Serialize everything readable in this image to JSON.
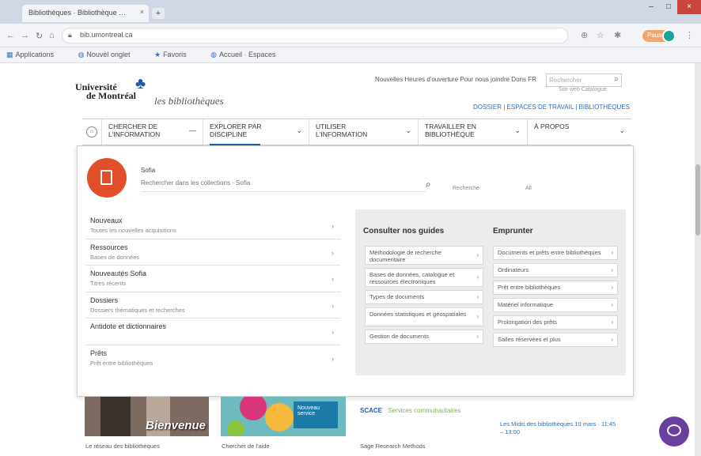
{
  "browser": {
    "tab_title": "Bibliothèques · Bibliothèque …",
    "url": "bib.umontreal.ca",
    "bookmarks": [
      "Applications",
      "Nouvel onglet",
      "Favoris",
      "Accueil · Espaces"
    ],
    "profile_label": "Pause"
  },
  "header": {
    "logo_line1": "Université",
    "logo_line2": "de Montréal",
    "logo_sub": "les bibliothèques",
    "top_links": "Nouvelles  Heures d'ouverture  Pour nous joindre  Dons  FR",
    "search_placeholder": "Rechercher",
    "search_sub": "Site web  Catalogue",
    "right_links": "DOSSIER  |  ESPACES DE TRAVAIL  |  BIBLIOTHÈQUES"
  },
  "nav": {
    "items": [
      {
        "label": "CHERCHER DE\nL'INFORMATION"
      },
      {
        "label": "EXPLORER PAR\nDISCIPLINE"
      },
      {
        "label": "UTILISER\nL'INFORMATION"
      },
      {
        "label": "TRAVAILLER EN\nBIBLIOTHÈQUE"
      },
      {
        "label": "À PROPOS"
      }
    ]
  },
  "mega": {
    "search_label": "Sofia",
    "search_placeholder": "Rechercher dans les collections · Sofia",
    "search_option1": "Recherche",
    "search_option2": "All",
    "left": [
      {
        "title": "Nouveaux",
        "sub": "Toutes les nouvelles acquisitions"
      },
      {
        "title": "Ressources",
        "sub": "Bases de données"
      },
      {
        "title": "Nouveautés Sofia",
        "sub": "Titres récents"
      },
      {
        "title": "Dossiers",
        "sub": "Dossiers thématiques et recherches"
      },
      {
        "title": "Antidote et dictionnaires",
        "sub": ""
      },
      {
        "title": "Prêts",
        "sub": "Prêt entre bibliothèques"
      }
    ],
    "guides_title": "Consulter nos guides",
    "guides": [
      "Méthodologie de recherche documentaire",
      "Bases de données, catalogue et ressources électroniques",
      "Types de documents",
      "Données statistiques et géospatiales",
      "Gestion de documents"
    ],
    "emprunter_title": "Emprunter",
    "emprunter": [
      "Documents et prêts entre bibliothèques",
      "Ordinateurs",
      "Prêt entre bibliothèques",
      "Matériel informatique",
      "Prolongation des prêts",
      "Salles réservées et plus"
    ]
  },
  "below": {
    "card1_text": "Bienvenue",
    "card2_text": "Nouveau service",
    "card3_brand": "SCACE",
    "card3_text": "Services communautaires",
    "card4_text": "Les Midis des bibliothèques 10 mars · 11:45 – 13:00",
    "cap1": "Le réseau des bibliothèques",
    "cap2": "Chercher de l'aide",
    "cap3": "Sage Research Methods"
  },
  "colors": {
    "brand_blue": "#1c5aa8",
    "avatar_orange": "#e14f2a",
    "chat_purple": "#6b3fa0"
  }
}
